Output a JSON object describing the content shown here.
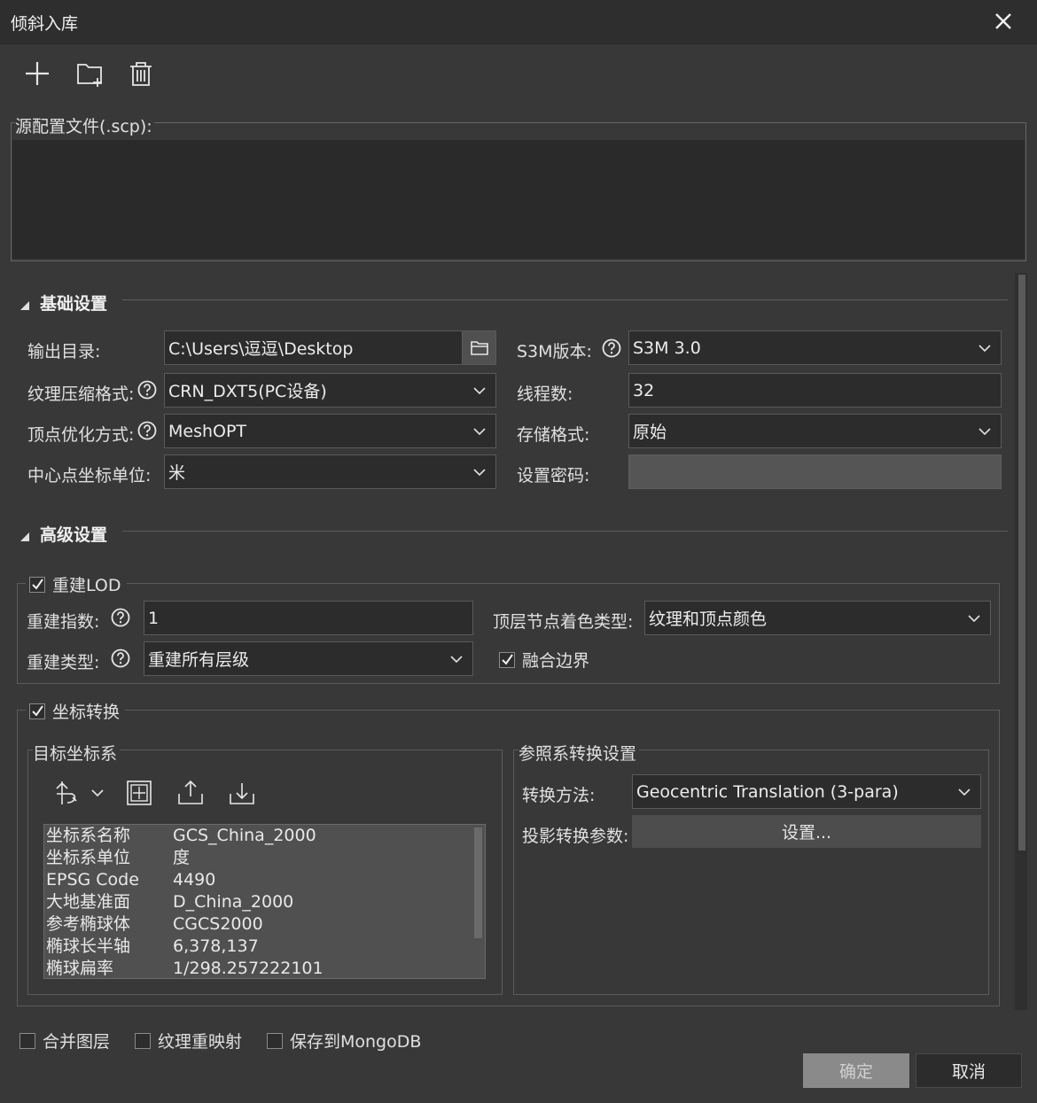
{
  "window": {
    "title": "倾斜入库"
  },
  "toolbar": {
    "add_icon": "plus-icon",
    "folder_icon": "add-folder-icon",
    "delete_icon": "trash-icon"
  },
  "source": {
    "label": "源配置文件(.scp):"
  },
  "basic": {
    "header": "基础设置",
    "output_dir_label": "输出目录:",
    "output_dir_value": "C:\\Users\\逗逗\\Desktop",
    "s3m_label": "S3M版本:",
    "s3m_value": "S3M 3.0",
    "texture_label": "纹理压缩格式:",
    "texture_value": "CRN_DXT5(PC设备)",
    "threads_label": "线程数:",
    "threads_value": "32",
    "vertex_label": "顶点优化方式:",
    "vertex_value": "MeshOPT",
    "storage_label": "存储格式:",
    "storage_value": "原始",
    "center_unit_label": "中心点坐标单位:",
    "center_unit_value": "米",
    "password_label": "设置密码:",
    "password_value": ""
  },
  "advanced": {
    "header": "高级设置",
    "rebuild_lod": {
      "label": "重建LOD",
      "checked": true
    },
    "rebuild_index_label": "重建指数:",
    "rebuild_index_value": "1",
    "top_color_label": "顶层节点着色类型:",
    "top_color_value": "纹理和顶点颜色",
    "rebuild_type_label": "重建类型:",
    "rebuild_type_value": "重建所有层级",
    "merge_border": {
      "label": "融合边界",
      "checked": true
    },
    "coord_transform": {
      "label": "坐标转换",
      "checked": true
    },
    "target_cs_label": "目标坐标系",
    "ref_transform_label": "参照系转换设置",
    "method_label": "转换方法:",
    "method_value": "Geocentric Translation (3-para)",
    "proj_params_label": "投影转换参数:",
    "proj_params_button": "设置...",
    "props": [
      {
        "k": "坐标系名称",
        "v": "GCS_China_2000"
      },
      {
        "k": "坐标系单位",
        "v": "度"
      },
      {
        "k": "EPSG Code",
        "v": "4490"
      },
      {
        "k": "大地基准面",
        "v": "D_China_2000"
      },
      {
        "k": "参考椭球体",
        "v": "CGCS2000"
      },
      {
        "k": "椭球长半轴",
        "v": "6,378,137"
      },
      {
        "k": "椭球扁率",
        "v": "1/298.257222101"
      }
    ]
  },
  "bottom": {
    "merge_layers": {
      "label": "合并图层",
      "checked": false
    },
    "texture_remap": {
      "label": "纹理重映射",
      "checked": false
    },
    "save_mongo": {
      "label": "保存到MongoDB",
      "checked": false
    },
    "ok": "确定",
    "cancel": "取消"
  },
  "colors": {
    "background": "#383838",
    "titlebar": "#2e2e2e",
    "field": "#2c2c2c",
    "disabled_button": "#8a8a8a"
  }
}
